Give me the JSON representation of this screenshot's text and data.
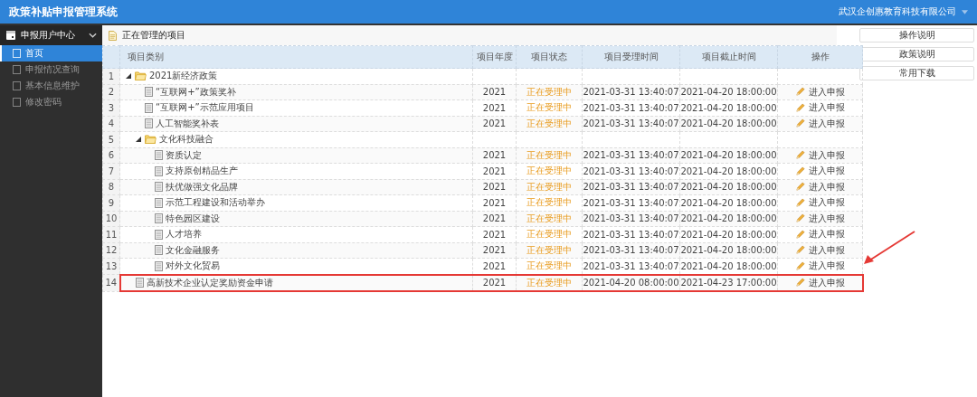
{
  "header": {
    "title": "政策补贴申报管理系统",
    "company": "武汉企创惠教育科技有限公司"
  },
  "sidebar": {
    "section": "申报用户中心",
    "expanded": true,
    "items": [
      {
        "label": "首页",
        "selected": true
      },
      {
        "label": "申报情况查询",
        "selected": false
      },
      {
        "label": "基本信息维护",
        "selected": false
      },
      {
        "label": "修改密码",
        "selected": false
      }
    ]
  },
  "panel": {
    "title": "正在管理的项目"
  },
  "table": {
    "columns": [
      "项目类别",
      "项目年度",
      "项目状态",
      "项目受理时间",
      "项目截止时间",
      "操作"
    ],
    "rows": [
      {
        "num": "1",
        "name": "2021新经济政策",
        "expanded": true,
        "children": [
          {
            "num": "2",
            "name": "“互联网+”政策奖补",
            "year": "2021",
            "status": "正在受理中",
            "accepted": "2021-03-31 13:40:07",
            "deadline": "2021-04-20 18:00:00",
            "action": "进入申报",
            "highlighted": false,
            "pointed": false
          },
          {
            "num": "3",
            "name": "“互联网+”示范应用项目",
            "year": "2021",
            "status": "正在受理中",
            "accepted": "2021-03-31 13:40:07",
            "deadline": "2021-04-20 18:00:00",
            "action": "进入申报",
            "highlighted": false,
            "pointed": false
          },
          {
            "num": "4",
            "name": "人工智能奖补表",
            "year": "2021",
            "status": "正在受理中",
            "accepted": "2021-03-31 13:40:07",
            "deadline": "2021-04-20 18:00:00",
            "action": "进入申报",
            "highlighted": false,
            "pointed": false
          },
          {
            "num": "5",
            "name": "文化科技融合",
            "expanded": true,
            "children": [
              {
                "num": "6",
                "name": "资质认定",
                "year": "2021",
                "status": "正在受理中",
                "accepted": "2021-03-31 13:40:07",
                "deadline": "2021-04-20 18:00:00",
                "action": "进入申报",
                "highlighted": false,
                "pointed": false
              },
              {
                "num": "7",
                "name": "支持原创精品生产",
                "year": "2021",
                "status": "正在受理中",
                "accepted": "2021-03-31 13:40:07",
                "deadline": "2021-04-20 18:00:00",
                "action": "进入申报",
                "highlighted": false,
                "pointed": false
              },
              {
                "num": "8",
                "name": "扶优做强文化品牌",
                "year": "2021",
                "status": "正在受理中",
                "accepted": "2021-03-31 13:40:07",
                "deadline": "2021-04-20 18:00:00",
                "action": "进入申报",
                "highlighted": false,
                "pointed": false
              },
              {
                "num": "9",
                "name": "示范工程建设和活动举办",
                "year": "2021",
                "status": "正在受理中",
                "accepted": "2021-03-31 13:40:07",
                "deadline": "2021-04-20 18:00:00",
                "action": "进入申报",
                "highlighted": false,
                "pointed": false
              },
              {
                "num": "10",
                "name": "特色园区建设",
                "year": "2021",
                "status": "正在受理中",
                "accepted": "2021-03-31 13:40:07",
                "deadline": "2021-04-20 18:00:00",
                "action": "进入申报",
                "highlighted": false,
                "pointed": false
              },
              {
                "num": "11",
                "name": "人才培养",
                "year": "2021",
                "status": "正在受理中",
                "accepted": "2021-03-31 13:40:07",
                "deadline": "2021-04-20 18:00:00",
                "action": "进入申报",
                "highlighted": false,
                "pointed": false
              },
              {
                "num": "12",
                "name": "文化金融服务",
                "year": "2021",
                "status": "正在受理中",
                "accepted": "2021-03-31 13:40:07",
                "deadline": "2021-04-20 18:00:00",
                "action": "进入申报",
                "highlighted": false,
                "pointed": false
              },
              {
                "num": "13",
                "name": "对外文化贸易",
                "year": "2021",
                "status": "正在受理中",
                "accepted": "2021-03-31 13:40:07",
                "deadline": "2021-04-20 18:00:00",
                "action": "进入申报",
                "highlighted": false,
                "pointed": true
              }
            ]
          }
        ]
      },
      {
        "num": "14",
        "name": "高新技术企业认定奖励资金申请",
        "year": "2021",
        "status": "正在受理中",
        "accepted": "2021-04-20 08:00:00",
        "deadline": "2021-04-23 17:00:00",
        "action": "进入申报",
        "highlighted": true,
        "pointed": false
      }
    ]
  },
  "side_buttons": [
    "操作说明",
    "政策说明",
    "常用下载"
  ]
}
